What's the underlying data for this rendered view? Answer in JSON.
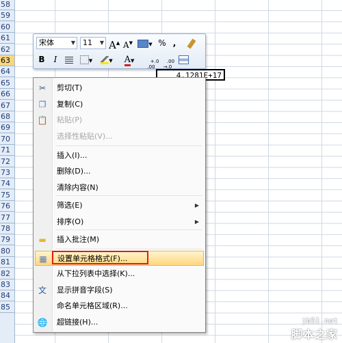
{
  "sheet": {
    "row_numbers": [
      "58",
      "59",
      "60",
      "61",
      "62",
      "63",
      "64",
      "65",
      "66",
      "67",
      "68",
      "69",
      "70",
      "71",
      "72",
      "73",
      "74",
      "75",
      "76",
      "77",
      "78",
      "79",
      "80",
      "81",
      "82",
      "83",
      "84",
      "85"
    ],
    "active_row": "63",
    "active_cell_value": "4.1281E+17"
  },
  "mini_toolbar": {
    "font_name": "宋体",
    "font_size": "11",
    "grow_font": "A",
    "shrink_font": "A",
    "percent": "%",
    "comma": ",",
    "bold": "B",
    "italic": "I",
    "font_color_letter": "A",
    "increase_decimal": "+.0\n.00",
    "decrease_decimal": ".00\n→.0",
    "accent_red": "#d42020",
    "accent_yellow": "#ffe600"
  },
  "context_menu": {
    "items": [
      {
        "label": "剪切(T)",
        "icon": "scissors-icon"
      },
      {
        "label": "复制(C)",
        "icon": "copy-icon"
      },
      {
        "label": "粘贴(P)",
        "icon": "paste-icon",
        "disabled": true
      },
      {
        "label": "选择性粘贴(V)...",
        "disabled": true
      },
      {
        "label": "插入(I)..."
      },
      {
        "label": "删除(D)..."
      },
      {
        "label": "清除内容(N)"
      },
      {
        "label": "筛选(E)",
        "submenu": true
      },
      {
        "label": "排序(O)",
        "submenu": true
      },
      {
        "label": "插入批注(M)",
        "icon": "comment-icon"
      },
      {
        "label": "设置单元格格式(F)...",
        "icon": "format-cells-icon",
        "highlighted": true
      },
      {
        "label": "从下拉列表中选择(K)..."
      },
      {
        "label": "显示拼音字段(S)",
        "icon": "phonetic-icon"
      },
      {
        "label": "命名单元格区域(R)..."
      },
      {
        "label": "超链接(H)...",
        "icon": "hyperlink-icon"
      }
    ],
    "highlight_color": "#ffd77f",
    "annotation_color": "#e01b1b"
  },
  "watermark": {
    "domain": "jb51.net",
    "name": "脚本之家"
  }
}
